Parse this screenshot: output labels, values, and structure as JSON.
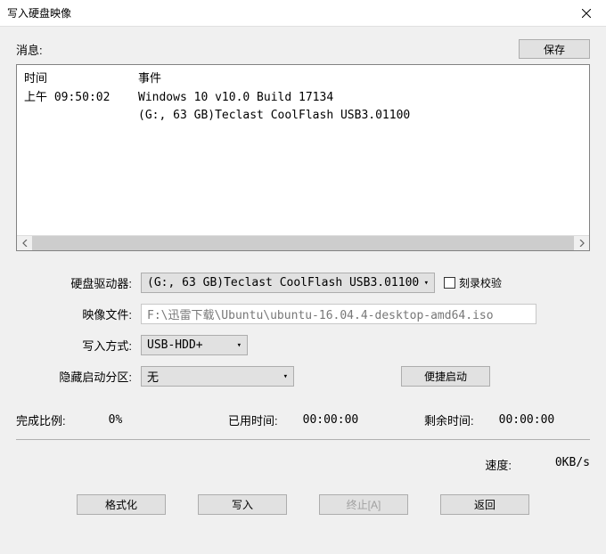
{
  "window": {
    "title": "写入硬盘映像"
  },
  "info": {
    "label": "消息:",
    "save_btn": "保存"
  },
  "log": {
    "time_header": "时间",
    "event_header": "事件",
    "rows": [
      {
        "time": "",
        "event": "Windows 10 v10.0 Build 17134"
      },
      {
        "time": "上午 09:50:02",
        "event": "(G:, 63 GB)Teclast CoolFlash USB3.01100"
      }
    ]
  },
  "form": {
    "drive_label": "硬盘驱动器:",
    "drive_value": "(G:, 63 GB)Teclast CoolFlash USB3.01100",
    "verify_label": "刻录校验",
    "image_label": "映像文件:",
    "image_value": "F:\\迅雷下载\\Ubuntu\\ubuntu-16.04.4-desktop-amd64.iso",
    "method_label": "写入方式:",
    "method_value": "USB-HDD+",
    "hidden_label": "隐藏启动分区:",
    "hidden_value": "无",
    "quick_boot_btn": "便捷启动"
  },
  "progress": {
    "ratio_label": "完成比例:",
    "ratio_value": "0%",
    "elapsed_label": "已用时间:",
    "elapsed_value": "00:00:00",
    "remain_label": "剩余时间:",
    "remain_value": "00:00:00",
    "speed_label": "速度:",
    "speed_value": "0KB/s"
  },
  "buttons": {
    "format": "格式化",
    "write": "写入",
    "abort": "终止[A]",
    "back": "返回"
  }
}
